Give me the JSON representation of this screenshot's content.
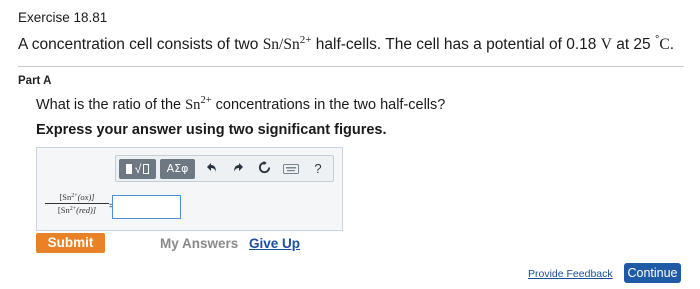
{
  "exercise_title": "Exercise 18.81",
  "problem": {
    "pre": "A concentration cell consists of two ",
    "formula_base": "Sn/Sn",
    "formula_sup": "2+",
    "mid": " half-cells. The cell has a potential of 0.18 ",
    "unit_v": "V",
    "mid2": " at 25 ",
    "deg": "°",
    "unit_c": "C",
    "post": "."
  },
  "part_label": "Part A",
  "question": {
    "pre": "What is the ratio of the ",
    "ion_base": "Sn",
    "ion_sup": "2+",
    "post": " concentrations in the two half-cells?"
  },
  "instruction": "Express your answer using two significant figures.",
  "toolbar": {
    "template_label": "√",
    "symbols_label": "ΑΣφ",
    "help_label": "?"
  },
  "expression": {
    "num_base": "[Sn",
    "num_sup": "2+",
    "num_tail": "(ox)]",
    "den_base": "[Sn",
    "den_sup": "2+",
    "den_tail": "(red)]",
    "equals": "="
  },
  "answer_input": {
    "value": "",
    "placeholder": ""
  },
  "submit_label": "Submit",
  "my_answers_label": "My Answers",
  "give_up_label": "Give Up",
  "feedback_label": "Provide Feedback",
  "continue_label": "Continue",
  "colors": {
    "submit": "#e98227",
    "link": "#1a4f9e",
    "continue": "#1f5aa6",
    "toolbar_button": "#6d7883"
  }
}
